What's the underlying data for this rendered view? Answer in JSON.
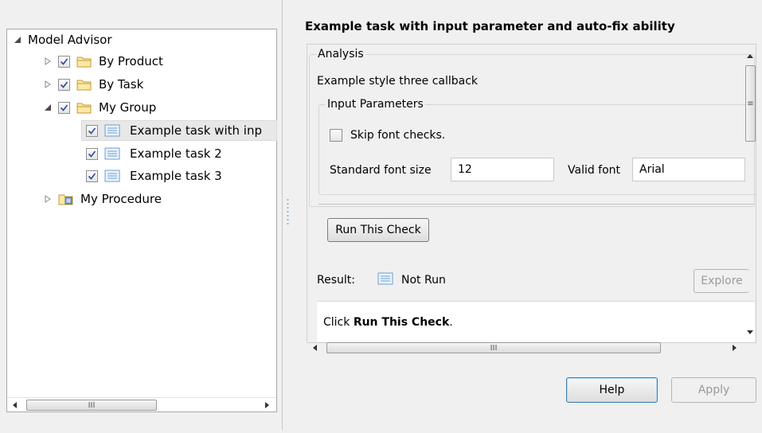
{
  "tree": {
    "root_label": "Model Advisor",
    "items": [
      {
        "label": "By Product"
      },
      {
        "label": "By Task"
      },
      {
        "label": "My Group"
      },
      {
        "label": "Example task with inp"
      },
      {
        "label": "Example task 2"
      },
      {
        "label": "Example task 3"
      },
      {
        "label": "My Procedure"
      }
    ],
    "hscroll_thumb": "III"
  },
  "details": {
    "title": "Example task with input parameter and auto-fix ability",
    "analysis_legend": "Analysis",
    "callback_text": "Example style three callback",
    "input_params_legend": "Input Parameters",
    "skip_font_checks_label": "Skip font checks.",
    "standard_font_size_label": "Standard font size",
    "standard_font_size_value": "12",
    "valid_font_label": "Valid font",
    "valid_font_value": "Arial",
    "run_button": "Run This Check",
    "result_label": "Result:",
    "result_status": "Not Run",
    "explore_button": "Explore",
    "result_message_prefix": "Click ",
    "result_message_bold": "Run This Check",
    "result_message_suffix": ".",
    "hscroll_thumb": "III",
    "vscroll_grip": "≡"
  },
  "buttons": {
    "help": "Help",
    "apply": "Apply"
  }
}
